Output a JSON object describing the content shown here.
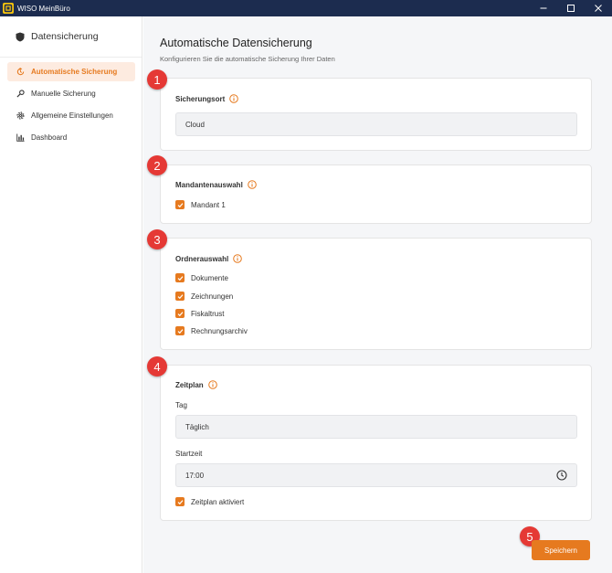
{
  "window": {
    "title": "WISO MeinBüro"
  },
  "sidebar": {
    "title": "Datensicherung",
    "items": [
      {
        "label": "Automatische Sicherung",
        "icon": "auto-backup-icon",
        "active": true
      },
      {
        "label": "Manuelle Sicherung",
        "icon": "manual-backup-icon",
        "active": false
      },
      {
        "label": "Allgemeine Einstellungen",
        "icon": "gear-icon",
        "active": false
      },
      {
        "label": "Dashboard",
        "icon": "bar-chart-icon",
        "active": false
      }
    ]
  },
  "main": {
    "title": "Automatische Datensicherung",
    "subtitle": "Konfigurieren Sie die automatische Sicherung Ihrer Daten"
  },
  "sections": {
    "location": {
      "title": "Sicherungsort",
      "value": "Cloud"
    },
    "clients": {
      "title": "Mandantenauswahl",
      "items": [
        {
          "label": "Mandant 1",
          "checked": true
        }
      ]
    },
    "folders": {
      "title": "Ordnerauswahl",
      "items": [
        {
          "label": "Dokumente",
          "checked": true
        },
        {
          "label": "Zeichnungen",
          "checked": true
        },
        {
          "label": "Fiskaltrust",
          "checked": true
        },
        {
          "label": "Rechnungsarchiv",
          "checked": true
        }
      ]
    },
    "schedule": {
      "title": "Zeitplan",
      "day_label": "Tag",
      "day_value": "Täglich",
      "start_label": "Startzeit",
      "start_value": "17:00",
      "enabled_label": "Zeitplan aktiviert",
      "enabled": true
    }
  },
  "badges": [
    "1",
    "2",
    "3",
    "4",
    "5"
  ],
  "actions": {
    "save_label": "Speichern"
  },
  "colors": {
    "accent": "#e67a1f",
    "titlebar": "#1c2c4f",
    "badge": "#e53935",
    "active_bg": "#fdebe0"
  }
}
